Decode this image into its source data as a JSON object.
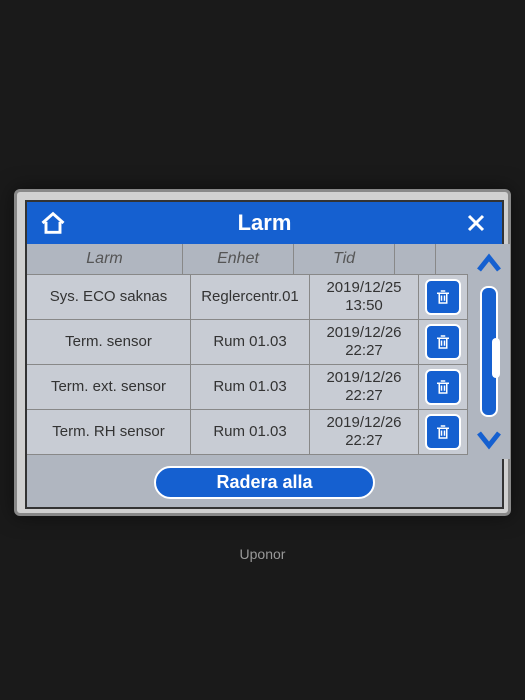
{
  "header": {
    "title": "Larm"
  },
  "columns": {
    "alarm": "Larm",
    "unit": "Enhet",
    "time": "Tid"
  },
  "alarms": [
    {
      "name": "Sys. ECO saknas",
      "unit": "Reglercentr.01",
      "date": "2019/12/25",
      "time": "13:50"
    },
    {
      "name": "Term. sensor",
      "unit": "Rum 01.03",
      "date": "2019/12/26",
      "time": "22:27"
    },
    {
      "name": "Term. ext. sensor",
      "unit": "Rum 01.03",
      "date": "2019/12/26",
      "time": "22:27"
    },
    {
      "name": "Term. RH sensor",
      "unit": "Rum 01.03",
      "date": "2019/12/26",
      "time": "22:27"
    }
  ],
  "footer": {
    "delete_all": "Radera alla"
  },
  "brand": "Uponor"
}
